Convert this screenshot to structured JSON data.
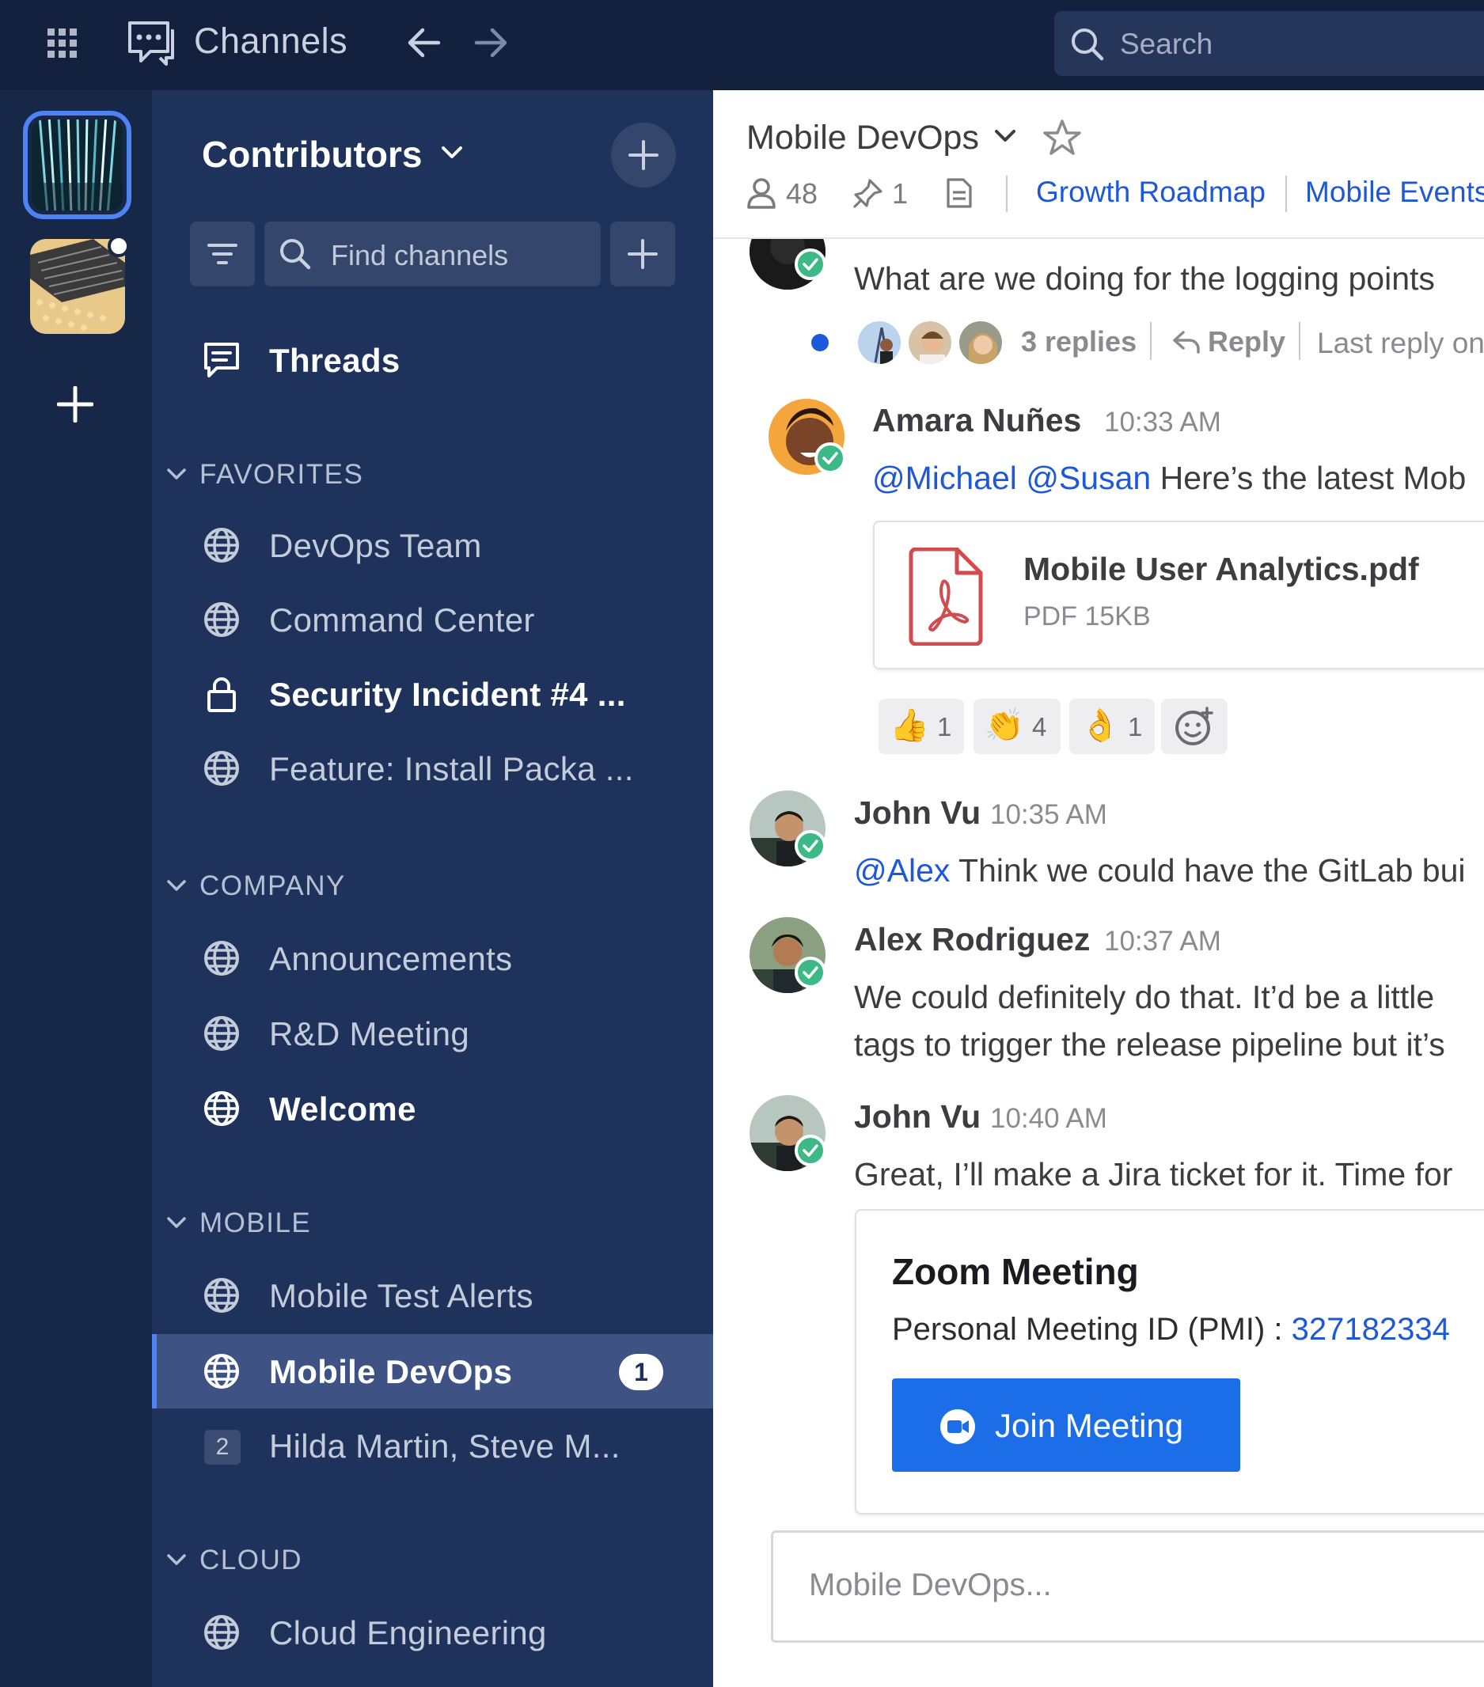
{
  "topbar": {
    "title": "Channels",
    "search_placeholder": "Search",
    "icons": [
      "apps-grid-icon",
      "channels-chat-icon",
      "arrow-left-icon",
      "arrow-right-icon",
      "search-icon"
    ]
  },
  "sidebar": {
    "team_name": "Contributors",
    "find_placeholder": "Find channels",
    "threads_label": "Threads",
    "sections": {
      "favorites": "FAVORITES",
      "company": "COMPANY",
      "mobile": "MOBILE",
      "cloud": "CLOUD"
    },
    "favorites": [
      {
        "label": "DevOps Team",
        "icon": "globe-icon"
      },
      {
        "label": "Command Center",
        "icon": "globe-icon"
      },
      {
        "label": "Security Incident #4 ...",
        "icon": "lock-icon",
        "bold": true
      },
      {
        "label": "Feature: Install Packa ...",
        "icon": "globe-icon"
      }
    ],
    "company": [
      {
        "label": "Announcements",
        "icon": "globe-icon"
      },
      {
        "label": "R&D Meeting",
        "icon": "globe-icon"
      },
      {
        "label": "Welcome",
        "icon": "globe-icon",
        "bold": true
      }
    ],
    "mobile": [
      {
        "label": "Mobile Test Alerts",
        "icon": "globe-icon"
      },
      {
        "label": "Mobile DevOps",
        "icon": "globe-icon",
        "active": true,
        "badge": "1"
      },
      {
        "label": "Hilda Martin, Steve M...",
        "icon": "group-dm",
        "dm_count": "2"
      }
    ],
    "cloud": [
      {
        "label": "Cloud Engineering",
        "icon": "globe-icon"
      }
    ]
  },
  "channel": {
    "name": "Mobile DevOps",
    "members": "48",
    "pinned": "1",
    "bookmarks": [
      "Growth Roadmap",
      "Mobile Events"
    ]
  },
  "messages": {
    "first": {
      "text": "What are we doing for the logging points",
      "replies": "3 replies",
      "reply_label": "Reply",
      "last_reply": "Last reply on"
    },
    "amara": {
      "author": "Amara Nuñes",
      "time": "10:33 AM",
      "mention1": "@Michael",
      "mention2": "@Susan",
      "text": "Here’s the latest Mob",
      "file_name": "Mobile User Analytics.pdf",
      "file_meta": "PDF 15KB",
      "reactions": [
        {
          "emoji": "👍",
          "count": "1"
        },
        {
          "emoji": "👏",
          "count": "4"
        },
        {
          "emoji": "👌",
          "count": "1"
        }
      ]
    },
    "john1": {
      "author": "John Vu",
      "time": "10:35 AM",
      "mention": "@Alex",
      "text": "Think we could have the GitLab bui"
    },
    "alex": {
      "author": "Alex Rodriguez",
      "time": "10:37 AM",
      "line1": "We could definitely do that. It’d be a little",
      "line2": "tags to trigger the release pipeline but it’s"
    },
    "john2": {
      "author": "John Vu",
      "time": "10:40 AM",
      "text": "Great, I’ll make a Jira ticket for it. Time for",
      "zoom_title": "Zoom Meeting",
      "zoom_pmi_label": "Personal Meeting ID (PMI) :",
      "zoom_pmi": "327182334",
      "join_label": "Join Meeting"
    }
  },
  "composer": {
    "placeholder": "Mobile DevOps..."
  },
  "colors": {
    "topbar": "#14213e",
    "sidebar": "#1e325c",
    "accent": "#1c58d9",
    "online": "#3db887",
    "button": "#1c6ee8"
  }
}
